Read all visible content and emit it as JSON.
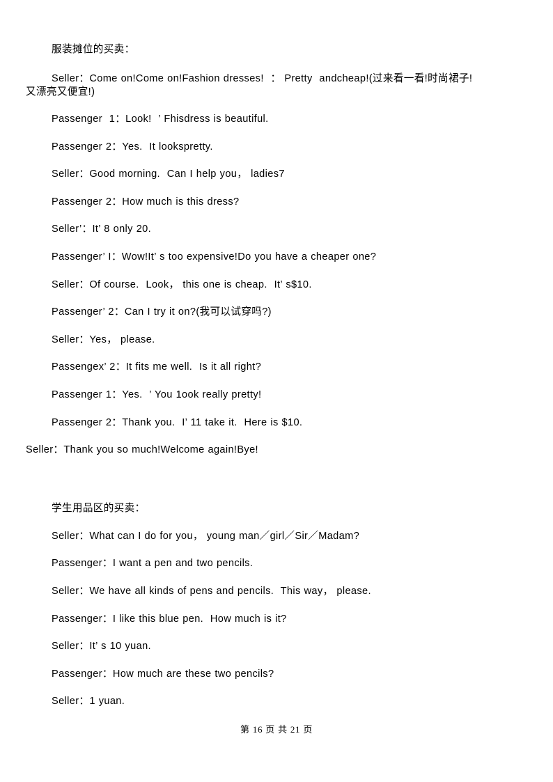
{
  "document": {
    "sections": [
      {
        "heading": "服装摊位的买卖：",
        "lines": [
          {
            "id": "line-seller-1",
            "text": "Seller：Come on!Come on!Fashion dresses!  ： Pretty  andcheap!(过来看一看!时尚裙子!",
            "wrap": "又漂亮又便宜!)",
            "style": "hang"
          },
          {
            "id": "line-passenger-1a",
            "text": "Passenger  1：Look!  ’ Fhisdress is beautiful.",
            "style": "indent"
          },
          {
            "id": "line-passenger-2a",
            "text": "Passenger 2：Yes.  It lookspretty.",
            "style": "indent"
          },
          {
            "id": "line-seller-2",
            "text": "Seller：Good morning.  Can I help you， ladies7",
            "style": "indent"
          },
          {
            "id": "line-passenger-2b",
            "text": "Passenger 2：How much is this dress?",
            "style": "indent"
          },
          {
            "id": "line-seller-3",
            "text": "Seller’：It’ 8 only 20.",
            "style": "indent"
          },
          {
            "id": "line-passenger-1b",
            "text": "Passenger’ I：Wow!It’ s too expensive!Do you have a cheaper one?",
            "style": "indent"
          },
          {
            "id": "line-seller-4",
            "text": "Seller：Of course.  Look， this one is cheap.  It’ s$10.",
            "style": "indent"
          },
          {
            "id": "line-passenger-2c",
            "text": "Passenger’ 2：Can I try it on?(我可以试穿吗?)",
            "style": "indent"
          },
          {
            "id": "line-seller-5",
            "text": "Seller：Yes， please.",
            "style": "indent"
          },
          {
            "id": "line-passenger-2d",
            "text": "Passengex’ 2：It fits me well.  Is it all right?",
            "style": "indent"
          },
          {
            "id": "line-passenger-1c",
            "text": "Passenger 1：Yes.  ’ You 1ook really pretty!",
            "style": "indent"
          },
          {
            "id": "line-passenger-2e",
            "text": "Passenger 2：Thank you.  I’ 11 take it.  Here is $10.",
            "style": "indent"
          },
          {
            "id": "line-seller-6",
            "text": "Seller：Thank you so much!Welcome again!Bye!",
            "style": "noindent"
          }
        ]
      },
      {
        "heading": "学生用品区的买卖：",
        "lines": [
          {
            "id": "line-seller-7",
            "text": "Seller：What can I do for you， young man／girl／Sir／Madam?",
            "style": "indent"
          },
          {
            "id": "line-passenger-3a",
            "text": "Passenger：I want a pen and two pencils.",
            "style": "indent"
          },
          {
            "id": "line-seller-8",
            "text": "Seller：We have all kinds of pens and pencils.  This way， please.",
            "style": "indent"
          },
          {
            "id": "line-passenger-3b",
            "text": "Passenger：I like this blue pen.  How much is it?",
            "style": "indent"
          },
          {
            "id": "line-seller-9",
            "text": "Seller：It’ s 10 yuan.",
            "style": "indent"
          },
          {
            "id": "line-passenger-3c",
            "text": "Passenger：How much are these two pencils?",
            "style": "indent"
          },
          {
            "id": "line-seller-10",
            "text": "Seller：1 yuan.",
            "style": "indent"
          }
        ]
      }
    ]
  },
  "footer": {
    "prefix": "第",
    "current_page": "16",
    "middle": "页 共",
    "total_pages": "21",
    "suffix": "页",
    "full_text": "第 16 页 共 21 页"
  },
  "colors": {
    "page_background": "#ffffff",
    "text": "#000000"
  }
}
